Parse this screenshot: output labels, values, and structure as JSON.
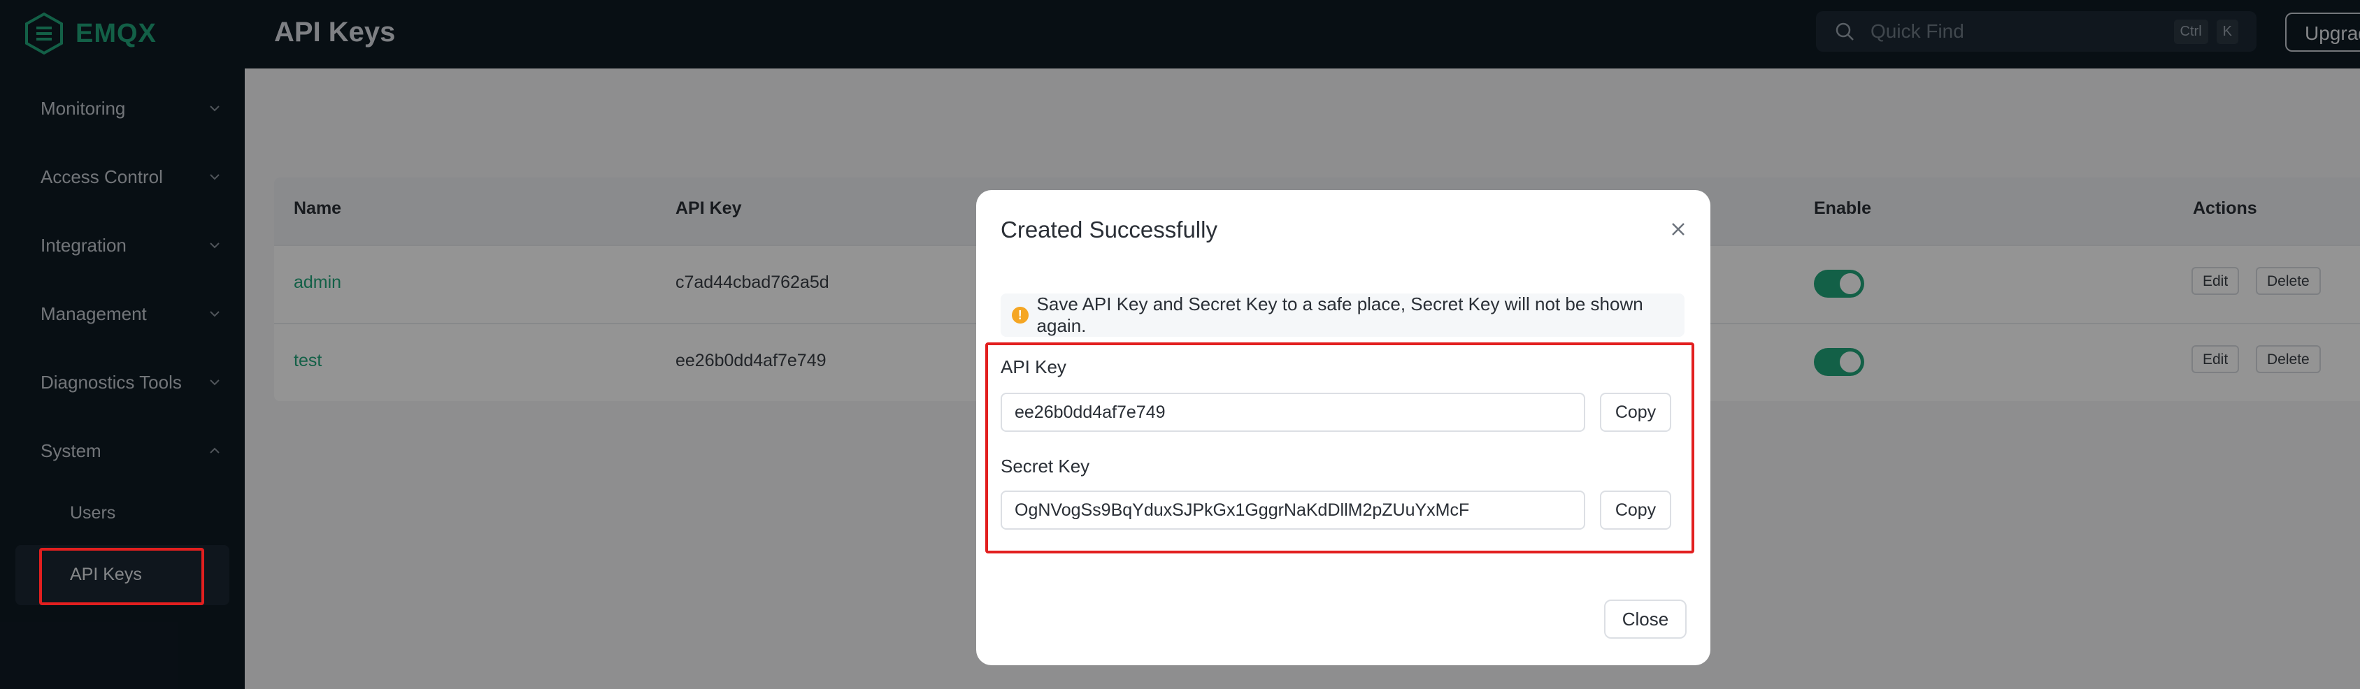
{
  "app": {
    "logo_text": "EMQX",
    "page_title": "API Keys",
    "brand_color": "#21a67a"
  },
  "header": {
    "quickfind_placeholder": "Quick Find",
    "shortcut_key_1": "Ctrl",
    "shortcut_key_2": "K",
    "upgrade_label": "Upgrad"
  },
  "sidebar": {
    "items": [
      {
        "label": "Monitoring"
      },
      {
        "label": "Access Control"
      },
      {
        "label": "Integration"
      },
      {
        "label": "Management"
      },
      {
        "label": "Diagnostics Tools"
      },
      {
        "label": "System"
      }
    ],
    "sub_items": [
      {
        "label": "Users"
      },
      {
        "label": "API Keys"
      }
    ]
  },
  "table": {
    "headers": {
      "name": "Name",
      "api_key": "API Key",
      "enable": "Enable",
      "actions": "Actions"
    },
    "rows": [
      {
        "name": "admin",
        "api_key": "c7ad44cbad762a5d",
        "enabled": true
      },
      {
        "name": "test",
        "api_key": "ee26b0dd4af7e749",
        "enabled": true
      }
    ],
    "edit_label": "Edit",
    "delete_label": "Delete"
  },
  "modal": {
    "title": "Created Successfully",
    "alert_icon": "!",
    "alert_text": "Save API Key and Secret Key to a safe place, Secret Key will not be shown again.",
    "api_key_label": "API Key",
    "api_key_value": "ee26b0dd4af7e749",
    "secret_key_label": "Secret Key",
    "secret_key_value": "OgNVogSs9BqYduxSJPkGx1GggrNaKdDllM2pZUuYxMcF",
    "copy_label": "Copy",
    "close_label": "Close"
  }
}
